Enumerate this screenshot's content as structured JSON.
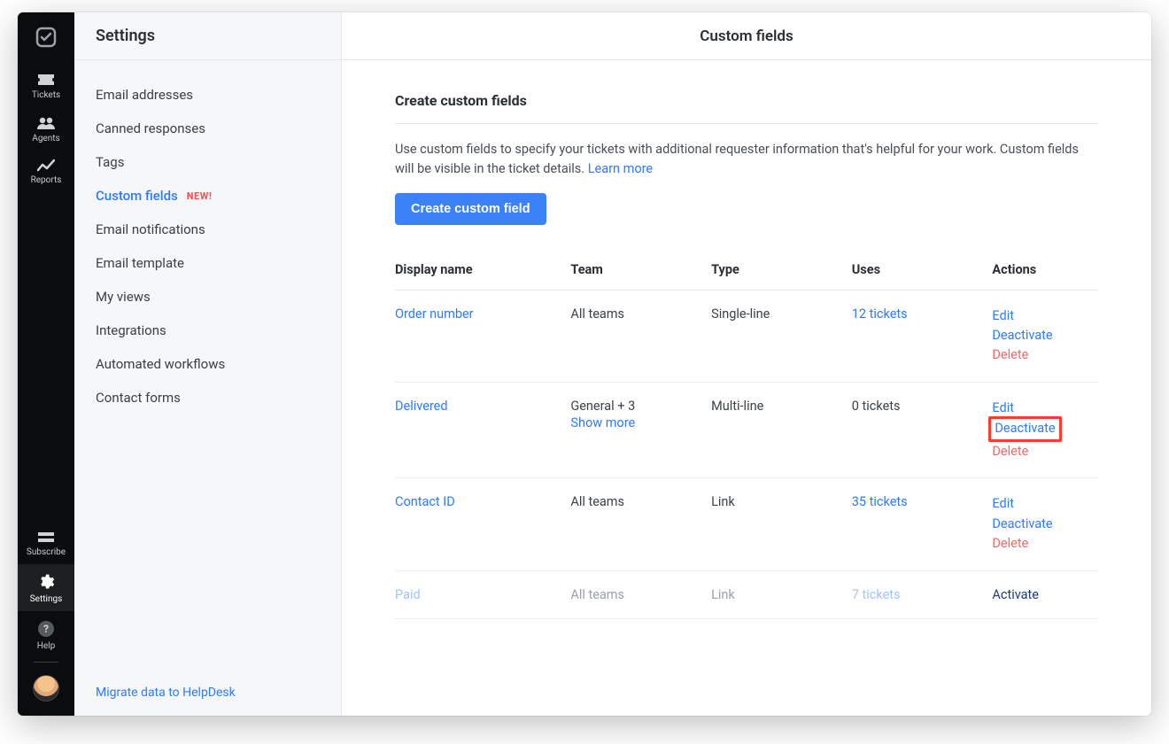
{
  "rail": {
    "items": [
      {
        "id": "tickets",
        "label": "Tickets"
      },
      {
        "id": "agents",
        "label": "Agents"
      },
      {
        "id": "reports",
        "label": "Reports"
      }
    ],
    "bottom": [
      {
        "id": "subscribe",
        "label": "Subscribe"
      },
      {
        "id": "settings",
        "label": "Settings",
        "active": true
      },
      {
        "id": "help",
        "label": "Help"
      }
    ]
  },
  "sidebar": {
    "title": "Settings",
    "items": [
      {
        "label": "Email addresses"
      },
      {
        "label": "Canned responses"
      },
      {
        "label": "Tags"
      },
      {
        "label": "Custom fields",
        "active": true,
        "badge": "NEW!"
      },
      {
        "label": "Email notifications"
      },
      {
        "label": "Email template"
      },
      {
        "label": "My views"
      },
      {
        "label": "Integrations"
      },
      {
        "label": "Automated workflows"
      },
      {
        "label": "Contact forms"
      }
    ],
    "footer_link": "Migrate data to HelpDesk"
  },
  "main": {
    "header_title": "Custom fields",
    "section_title": "Create custom fields",
    "description": "Use custom fields to specify your tickets with additional requester information that's helpful for your work. Custom fields will be visible in the ticket details. ",
    "learn_more": "Learn more",
    "create_button": "Create custom field",
    "columns": [
      "Display name",
      "Team",
      "Type",
      "Uses",
      "Actions"
    ],
    "actions_labels": {
      "edit": "Edit",
      "deactivate": "Deactivate",
      "delete": "Delete",
      "activate": "Activate"
    },
    "show_more_label": "Show more",
    "rows": [
      {
        "name": "Order number",
        "team": "All teams",
        "type": "Single-line",
        "uses": "12 tickets",
        "uses_link": true,
        "actions": [
          "edit",
          "deactivate",
          "delete"
        ]
      },
      {
        "name": "Delivered",
        "team": "General + 3",
        "team_show_more": true,
        "type": "Multi-line",
        "uses": "0 tickets",
        "uses_link": false,
        "actions": [
          "edit",
          "deactivate",
          "delete"
        ],
        "highlight_deactivate": true
      },
      {
        "name": "Contact ID",
        "team": "All teams",
        "type": "Link",
        "uses": "35 tickets",
        "uses_link": true,
        "actions": [
          "edit",
          "deactivate",
          "delete"
        ]
      },
      {
        "name": "Paid",
        "team": "All teams",
        "type": "Link",
        "uses": "7 tickets",
        "uses_link": true,
        "actions": [
          "activate"
        ],
        "disabled": true
      }
    ]
  }
}
